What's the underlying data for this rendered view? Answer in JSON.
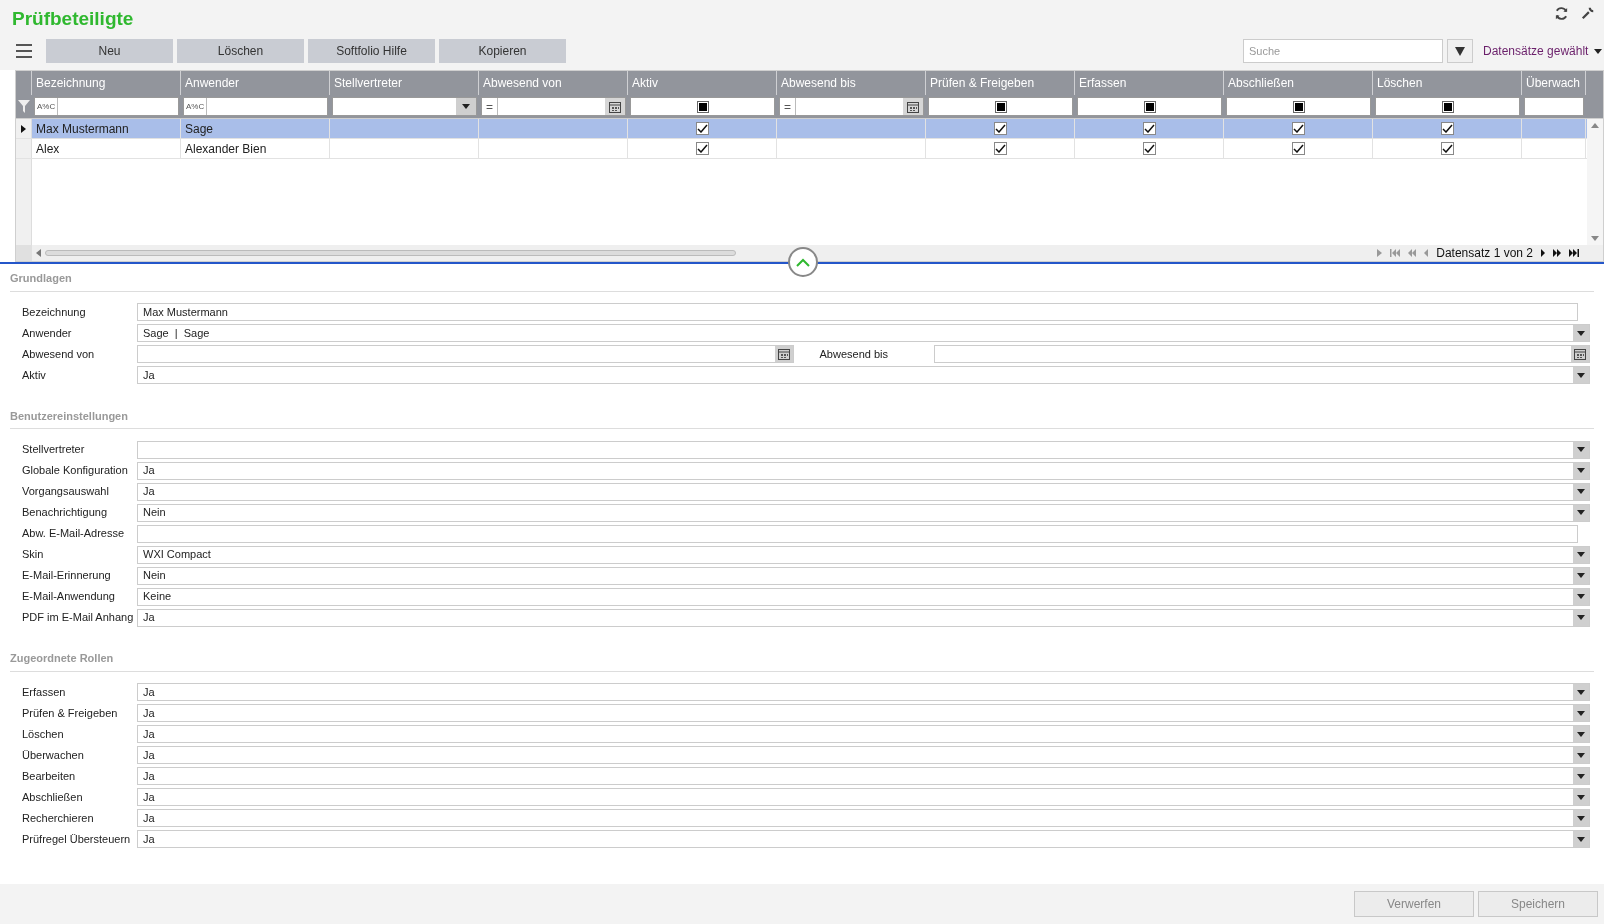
{
  "title": "Prüfbeteiligte",
  "toolbar": {
    "buttons": [
      "Neu",
      "Löschen",
      "Softfolio Hilfe",
      "Kopieren"
    ],
    "search": {
      "placeholder": "Suche"
    },
    "selection_label": "Datensätze gewählt"
  },
  "grid": {
    "columns": [
      {
        "label": "Bezeichnung",
        "filter": {
          "kind": "text",
          "operator": "A%C"
        }
      },
      {
        "label": "Anwender",
        "filter": {
          "kind": "text",
          "operator": "A%C"
        }
      },
      {
        "label": "Stellvertreter",
        "filter": {
          "kind": "dropdown"
        }
      },
      {
        "label": "Abwesend von",
        "filter": {
          "kind": "date",
          "operator": "="
        }
      },
      {
        "label": "Aktiv",
        "filter": {
          "kind": "check",
          "indeterminate": true
        }
      },
      {
        "label": "Abwesend bis",
        "filter": {
          "kind": "date",
          "operator": "="
        }
      },
      {
        "label": "Prüfen & Freigeben",
        "filter": {
          "kind": "check",
          "indeterminate": true
        }
      },
      {
        "label": "Erfassen",
        "filter": {
          "kind": "check",
          "indeterminate": true
        }
      },
      {
        "label": "Abschließen",
        "filter": {
          "kind": "check",
          "indeterminate": true
        }
      },
      {
        "label": "Löschen",
        "filter": {
          "kind": "check",
          "indeterminate": true
        }
      },
      {
        "label": "Überwach",
        "filter": {
          "kind": "text"
        }
      }
    ],
    "rows": [
      {
        "selected": true,
        "cells": [
          {
            "text": "Max Mustermann"
          },
          {
            "text": "Sage"
          },
          {},
          {},
          {
            "checked": true
          },
          {},
          {
            "checked": true
          },
          {
            "checked": true
          },
          {
            "checked": true
          },
          {
            "checked": true
          },
          {}
        ]
      },
      {
        "selected": false,
        "cells": [
          {
            "text": "Alex"
          },
          {
            "text": "Alexander Bien"
          },
          {},
          {},
          {
            "checked": true
          },
          {},
          {
            "checked": true
          },
          {
            "checked": true
          },
          {
            "checked": true
          },
          {
            "checked": true
          },
          {}
        ]
      }
    ],
    "pager": "Datensatz 1 von 2"
  },
  "sections": [
    {
      "title": "Grundlagen",
      "fields": [
        {
          "kind": "text",
          "label": "Bezeichnung",
          "value": "Max Mustermann"
        },
        {
          "kind": "dropdown",
          "label": "Anwender",
          "value": "Sage  |  Sage"
        },
        {
          "kind": "date_range",
          "label": "Abwesend von",
          "label_2": "Abwesend bis"
        },
        {
          "kind": "dropdown",
          "label": "Aktiv",
          "value": "Ja"
        }
      ]
    },
    {
      "title": "Benutzereinstellungen",
      "fields": [
        {
          "kind": "dropdown",
          "label": "Stellvertreter"
        },
        {
          "kind": "dropdown",
          "label": "Globale Konfiguration",
          "value": "Ja"
        },
        {
          "kind": "dropdown",
          "label": "Vorgangsauswahl",
          "value": "Ja"
        },
        {
          "kind": "dropdown",
          "label": "Benachrichtigung",
          "value": "Nein"
        },
        {
          "kind": "text",
          "label": "Abw. E-Mail-Adresse"
        },
        {
          "kind": "dropdown",
          "label": "Skin",
          "value": "WXI Compact"
        },
        {
          "kind": "dropdown",
          "label": "E-Mail-Erinnerung",
          "value": "Nein"
        },
        {
          "kind": "dropdown",
          "label": "E-Mail-Anwendung",
          "value": "Keine"
        },
        {
          "kind": "dropdown",
          "label": "PDF im E-Mail Anhang",
          "value": "Ja"
        }
      ]
    },
    {
      "title": "Zugeordnete Rollen",
      "fields": [
        {
          "kind": "dropdown",
          "label": "Erfassen",
          "value": "Ja"
        },
        {
          "kind": "dropdown",
          "label": "Prüfen & Freigeben",
          "value": "Ja"
        },
        {
          "kind": "dropdown",
          "label": "Löschen",
          "value": "Ja"
        },
        {
          "kind": "dropdown",
          "label": "Überwachen",
          "value": "Ja"
        },
        {
          "kind": "dropdown",
          "label": "Bearbeiten",
          "value": "Ja"
        },
        {
          "kind": "dropdown",
          "label": "Abschließen",
          "value": "Ja"
        },
        {
          "kind": "dropdown",
          "label": "Recherchieren",
          "value": "Ja"
        },
        {
          "kind": "dropdown",
          "label": "Prüfregel Übersteuern",
          "value": "Ja"
        }
      ]
    }
  ],
  "footer": {
    "buttons": [
      "Verwerfen",
      "Speichern"
    ]
  }
}
